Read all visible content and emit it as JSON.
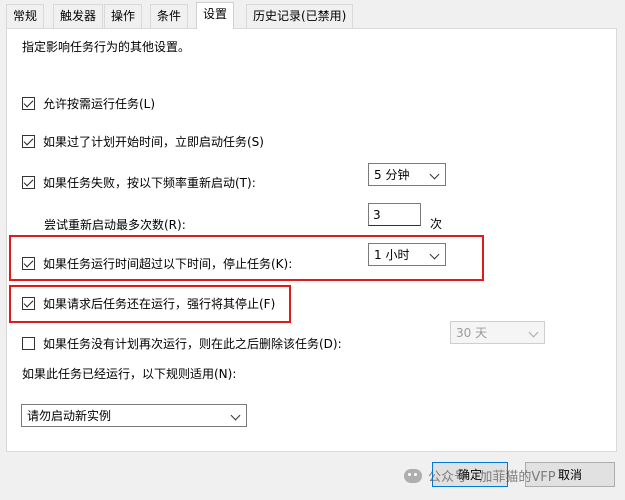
{
  "tabs": [
    {
      "label": "常规"
    },
    {
      "label": "触发器"
    },
    {
      "label": "操作"
    },
    {
      "label": "条件"
    },
    {
      "label": "设置"
    },
    {
      "label": "历史记录(已禁用)"
    }
  ],
  "description": "指定影响任务行为的其他设置。",
  "options": {
    "allow_on_demand": "允许按需运行任务(L)",
    "run_if_missed": "如果过了计划开始时间，立即启动任务(S)",
    "restart_on_failure": "如果任务失败，按以下频率重新启动(T):",
    "restart_interval": "5 分钟",
    "restart_attempts_label": "尝试重新启动最多次数(R):",
    "restart_attempts_value": "3",
    "restart_attempts_unit": "次",
    "stop_if_runs_longer": "如果任务运行时间超过以下时间，停止任务(K):",
    "stop_duration": "1 小时",
    "force_stop": "如果请求后任务还在运行，强行将其停止(F)",
    "delete_if_not_scheduled": "如果任务没有计划再次运行，则在此之后删除该任务(D):",
    "delete_after": "30 天",
    "running_rule_label": "如果此任务已经运行，以下规则适用(N):",
    "running_rule_value": "请勿启动新实例"
  },
  "buttons": {
    "ok": "确定",
    "cancel": "取消"
  },
  "watermark": "公众号 · 加菲猫的VFP",
  "colors": {
    "highlight": "#e0191b",
    "primary_border": "#0078d7"
  }
}
